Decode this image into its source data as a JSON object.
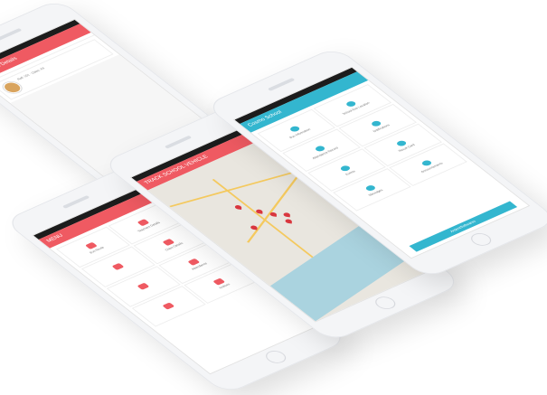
{
  "phones": {
    "profile": {
      "title": "Teachers Details",
      "tabs": [
        "",
        "",
        ""
      ],
      "name": "Roll: 101 · Class: XII"
    },
    "menu": {
      "title": "MENU",
      "items": [
        "Bus Route",
        "Teachers Details",
        "",
        "Class Details",
        "",
        "Attendance",
        "",
        "Notices",
        "Messages",
        ""
      ]
    },
    "map": {
      "title": "TRACK SCHOOL VEHICLE"
    },
    "school": {
      "title": "Cosmo School",
      "items": [
        "Bus Information",
        "School Bus Location",
        "Attendance Record",
        "Notifications",
        "Events",
        "Result Card",
        "Messages",
        "Announcements"
      ],
      "footer": "ArdentSoftwares"
    }
  },
  "colors": {
    "accent_red": "#ef5a62",
    "accent_teal": "#33b6cf"
  }
}
